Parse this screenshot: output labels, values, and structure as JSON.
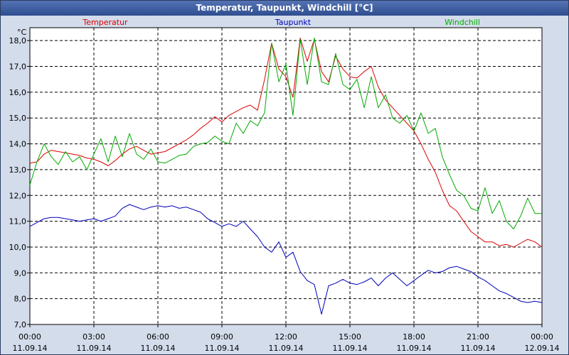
{
  "title": "Temperatur, Taupunkt, Windchill [°C]",
  "chart_data": {
    "type": "line",
    "title": "Temperatur, Taupunkt, Windchill [°C]",
    "ylabel": "°C",
    "ylim": [
      7.0,
      18.5
    ],
    "y_ticks": [
      7.0,
      8.0,
      9.0,
      10.0,
      11.0,
      12.0,
      13.0,
      14.0,
      15.0,
      16.0,
      17.0,
      18.0
    ],
    "y_tick_labels": [
      "7,0",
      "8,0",
      "9,0",
      "10,0",
      "11,0",
      "12,0",
      "13,0",
      "14,0",
      "15,0",
      "16,0",
      "17,0",
      "18,0"
    ],
    "x_ticks_hours": [
      0,
      3,
      6,
      9,
      12,
      15,
      18,
      21,
      24
    ],
    "x_tick_labels": [
      {
        "time": "00:00",
        "date": "11.09.14"
      },
      {
        "time": "03:00",
        "date": "11.09.14"
      },
      {
        "time": "06:00",
        "date": "11.09.14"
      },
      {
        "time": "09:00",
        "date": "11.09.14"
      },
      {
        "time": "12:00",
        "date": "11.09.14"
      },
      {
        "time": "15:00",
        "date": "11.09.14"
      },
      {
        "time": "18:00",
        "date": "11.09.14"
      },
      {
        "time": "21:00",
        "date": "11.09.14"
      },
      {
        "time": "00:00",
        "date": "12.09.14"
      }
    ],
    "grid": true,
    "legend_position": "top",
    "series": [
      {
        "name": "Temperatur",
        "color": "#dd0000",
        "x": [
          0,
          0.33,
          0.67,
          1,
          1.33,
          1.67,
          2,
          2.33,
          2.67,
          3,
          3.33,
          3.67,
          4,
          4.33,
          4.67,
          5,
          5.33,
          5.67,
          6,
          6.33,
          6.67,
          7,
          7.33,
          7.67,
          8,
          8.33,
          8.67,
          9,
          9.33,
          9.67,
          10,
          10.33,
          10.67,
          11,
          11.33,
          11.67,
          12,
          12.33,
          12.67,
          13,
          13.33,
          13.67,
          14,
          14.33,
          14.67,
          15,
          15.33,
          15.67,
          16,
          16.33,
          16.67,
          17,
          17.33,
          17.67,
          18,
          18.33,
          18.67,
          19,
          19.33,
          19.67,
          20,
          20.33,
          20.67,
          21,
          21.33,
          21.67,
          22,
          22.33,
          22.67,
          23,
          23.33,
          23.67,
          24
        ],
        "y": [
          13.25,
          13.3,
          13.6,
          13.75,
          13.7,
          13.65,
          13.6,
          13.55,
          13.45,
          13.4,
          13.3,
          13.15,
          13.35,
          13.6,
          13.8,
          13.9,
          13.75,
          13.6,
          13.65,
          13.7,
          13.85,
          14.0,
          14.15,
          14.35,
          14.6,
          14.8,
          15.05,
          14.85,
          15.1,
          15.25,
          15.4,
          15.5,
          15.3,
          16.5,
          17.9,
          16.9,
          16.6,
          15.8,
          18.1,
          17.2,
          18.05,
          16.8,
          16.4,
          17.4,
          16.9,
          16.6,
          16.55,
          16.8,
          17.0,
          16.2,
          15.7,
          15.4,
          15.1,
          14.8,
          14.5,
          14.0,
          13.4,
          12.9,
          12.2,
          11.6,
          11.4,
          11.0,
          10.6,
          10.4,
          10.2,
          10.2,
          10.05,
          10.1,
          10.0,
          10.15,
          10.3,
          10.2,
          10.0
        ]
      },
      {
        "name": "Taupunkt",
        "color": "#0000bb",
        "x": [
          0,
          0.33,
          0.67,
          1,
          1.33,
          1.67,
          2,
          2.33,
          2.67,
          3,
          3.33,
          3.67,
          4,
          4.33,
          4.67,
          5,
          5.33,
          5.67,
          6,
          6.33,
          6.67,
          7,
          7.33,
          7.67,
          8,
          8.33,
          8.67,
          9,
          9.33,
          9.67,
          10,
          10.33,
          10.67,
          11,
          11.33,
          11.67,
          12,
          12.33,
          12.67,
          13,
          13.33,
          13.67,
          14,
          14.33,
          14.67,
          15,
          15.33,
          15.67,
          16,
          16.33,
          16.67,
          17,
          17.33,
          17.67,
          18,
          18.33,
          18.67,
          19,
          19.33,
          19.67,
          20,
          20.33,
          20.67,
          21,
          21.33,
          21.67,
          22,
          22.33,
          22.67,
          23,
          23.33,
          23.67,
          24
        ],
        "y": [
          10.8,
          10.95,
          11.1,
          11.15,
          11.15,
          11.1,
          11.05,
          11.0,
          11.05,
          11.1,
          11.0,
          11.1,
          11.2,
          11.5,
          11.65,
          11.55,
          11.45,
          11.55,
          11.6,
          11.55,
          11.6,
          11.5,
          11.55,
          11.45,
          11.35,
          11.1,
          10.95,
          10.8,
          10.9,
          10.8,
          11.0,
          10.7,
          10.4,
          10.0,
          9.8,
          10.2,
          9.6,
          9.8,
          9.05,
          8.7,
          8.55,
          7.4,
          8.5,
          8.6,
          8.75,
          8.6,
          8.55,
          8.65,
          8.8,
          8.5,
          8.8,
          9.0,
          8.75,
          8.5,
          8.7,
          8.9,
          9.1,
          9.0,
          9.05,
          9.2,
          9.25,
          9.15,
          9.05,
          8.85,
          8.7,
          8.5,
          8.3,
          8.2,
          8.05,
          7.9,
          7.85,
          7.9,
          7.85
        ]
      },
      {
        "name": "Windchill",
        "color": "#00aa00",
        "x": [
          0,
          0.33,
          0.67,
          1,
          1.33,
          1.67,
          2,
          2.33,
          2.67,
          3,
          3.33,
          3.67,
          4,
          4.33,
          4.67,
          5,
          5.33,
          5.67,
          6,
          6.33,
          6.67,
          7,
          7.33,
          7.67,
          8,
          8.33,
          8.67,
          9,
          9.33,
          9.67,
          10,
          10.33,
          10.67,
          11,
          11.33,
          11.67,
          12,
          12.33,
          12.67,
          13,
          13.33,
          13.67,
          14,
          14.33,
          14.67,
          15,
          15.33,
          15.67,
          16,
          16.33,
          16.67,
          17,
          17.33,
          17.67,
          18,
          18.33,
          18.67,
          19,
          19.33,
          19.67,
          20,
          20.33,
          20.67,
          21,
          21.33,
          21.67,
          22,
          22.33,
          22.67,
          23,
          23.33,
          23.67,
          24
        ],
        "y": [
          12.4,
          13.3,
          14.0,
          13.5,
          13.2,
          13.7,
          13.3,
          13.5,
          13.0,
          13.6,
          14.2,
          13.3,
          14.3,
          13.5,
          14.4,
          13.6,
          13.4,
          13.8,
          13.3,
          13.25,
          13.4,
          13.55,
          13.6,
          13.9,
          14.0,
          14.05,
          14.3,
          14.1,
          14.0,
          14.8,
          14.4,
          14.9,
          14.7,
          15.2,
          17.9,
          16.4,
          17.1,
          15.1,
          18.05,
          16.3,
          18.1,
          16.4,
          16.3,
          17.5,
          16.3,
          16.1,
          16.5,
          15.4,
          16.6,
          15.4,
          15.9,
          15.0,
          14.8,
          15.1,
          14.5,
          15.2,
          14.4,
          14.6,
          13.5,
          12.8,
          12.2,
          12.0,
          11.5,
          11.4,
          12.3,
          11.3,
          11.8,
          11.0,
          10.7,
          11.2,
          11.9,
          11.3,
          11.3
        ]
      }
    ]
  }
}
